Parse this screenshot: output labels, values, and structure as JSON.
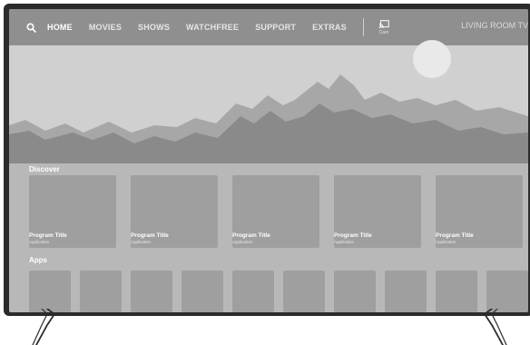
{
  "nav": {
    "items": [
      {
        "label": "HOME",
        "active": true
      },
      {
        "label": "MOVIES",
        "active": false
      },
      {
        "label": "SHOWS",
        "active": false
      },
      {
        "label": "WATCHFREE",
        "active": false
      },
      {
        "label": "SUPPORT",
        "active": false
      },
      {
        "label": "EXTRAS",
        "active": false
      }
    ],
    "cast_label": "Cast",
    "device_label": "LIVING ROOM TV"
  },
  "discover": {
    "title": "Discover",
    "cards": [
      {
        "title": "Program Title",
        "subtitle": "Application"
      },
      {
        "title": "Program Title",
        "subtitle": "Application"
      },
      {
        "title": "Program Title",
        "subtitle": "Application"
      },
      {
        "title": "Program Title",
        "subtitle": "Application"
      },
      {
        "title": "Program Title",
        "subtitle": "Application"
      }
    ]
  },
  "apps": {
    "title": "Apps",
    "count": 10
  },
  "colors": {
    "nav_bg": "#8f8f8f",
    "screen_bg": "#b8b8b8",
    "card_bg": "#9f9f9f",
    "hero_bg": "#d0d0d0",
    "mountain_dark": "#8a8a8a",
    "mountain_mid": "#a7a7a7",
    "frame": "#2b2b2b"
  }
}
